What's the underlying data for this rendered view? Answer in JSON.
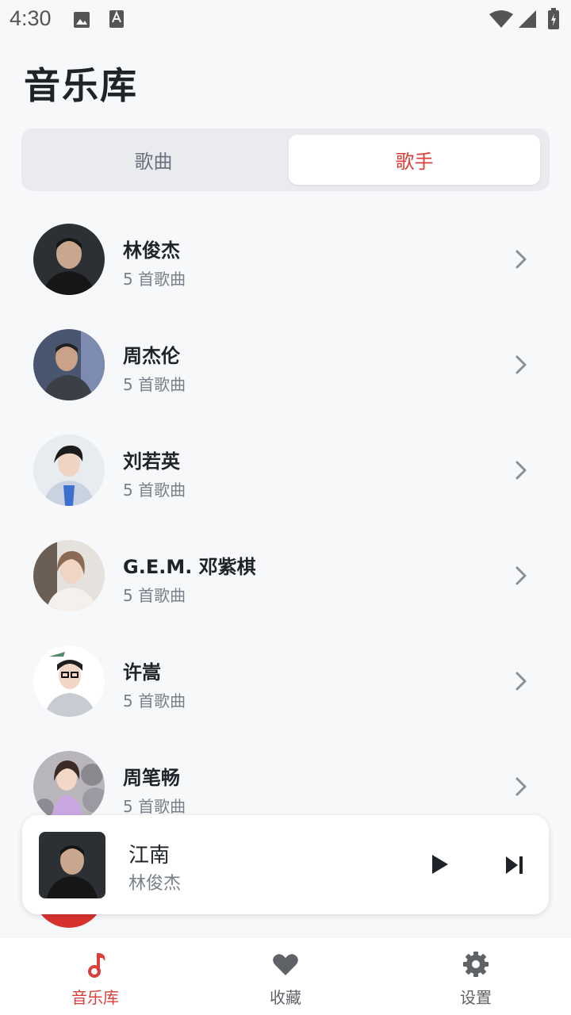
{
  "status_bar": {
    "time": "4:30",
    "icons": [
      "image-icon",
      "a-text-icon",
      "wifi-icon",
      "cellular-icon",
      "battery-charging-icon"
    ]
  },
  "page": {
    "title": "音乐库"
  },
  "tabs": [
    {
      "label": "歌曲",
      "selected": false
    },
    {
      "label": "歌手",
      "selected": true
    }
  ],
  "artists": [
    {
      "name": "林俊杰",
      "count": "5 首歌曲"
    },
    {
      "name": "周杰伦",
      "count": "5 首歌曲"
    },
    {
      "name": "刘若英",
      "count": "5 首歌曲"
    },
    {
      "name": "G.E.M. 邓紫棋",
      "count": "5 首歌曲"
    },
    {
      "name": "许嵩",
      "count": "5 首歌曲"
    },
    {
      "name": "周笔畅",
      "count": "5 首歌曲"
    }
  ],
  "mini_player": {
    "title": "江南",
    "artist": "林俊杰",
    "icons": [
      "play-icon",
      "skip-next-icon"
    ]
  },
  "bottom_nav": [
    {
      "label": "音乐库",
      "icon": "music-note-icon",
      "active": true
    },
    {
      "label": "收藏",
      "icon": "heart-icon",
      "active": false
    },
    {
      "label": "设置",
      "icon": "gear-icon",
      "active": false
    }
  ],
  "colors": {
    "accent": "#d9403a",
    "background": "#f7f8fa",
    "text_primary": "#1f2329",
    "text_secondary": "#7a8089"
  }
}
